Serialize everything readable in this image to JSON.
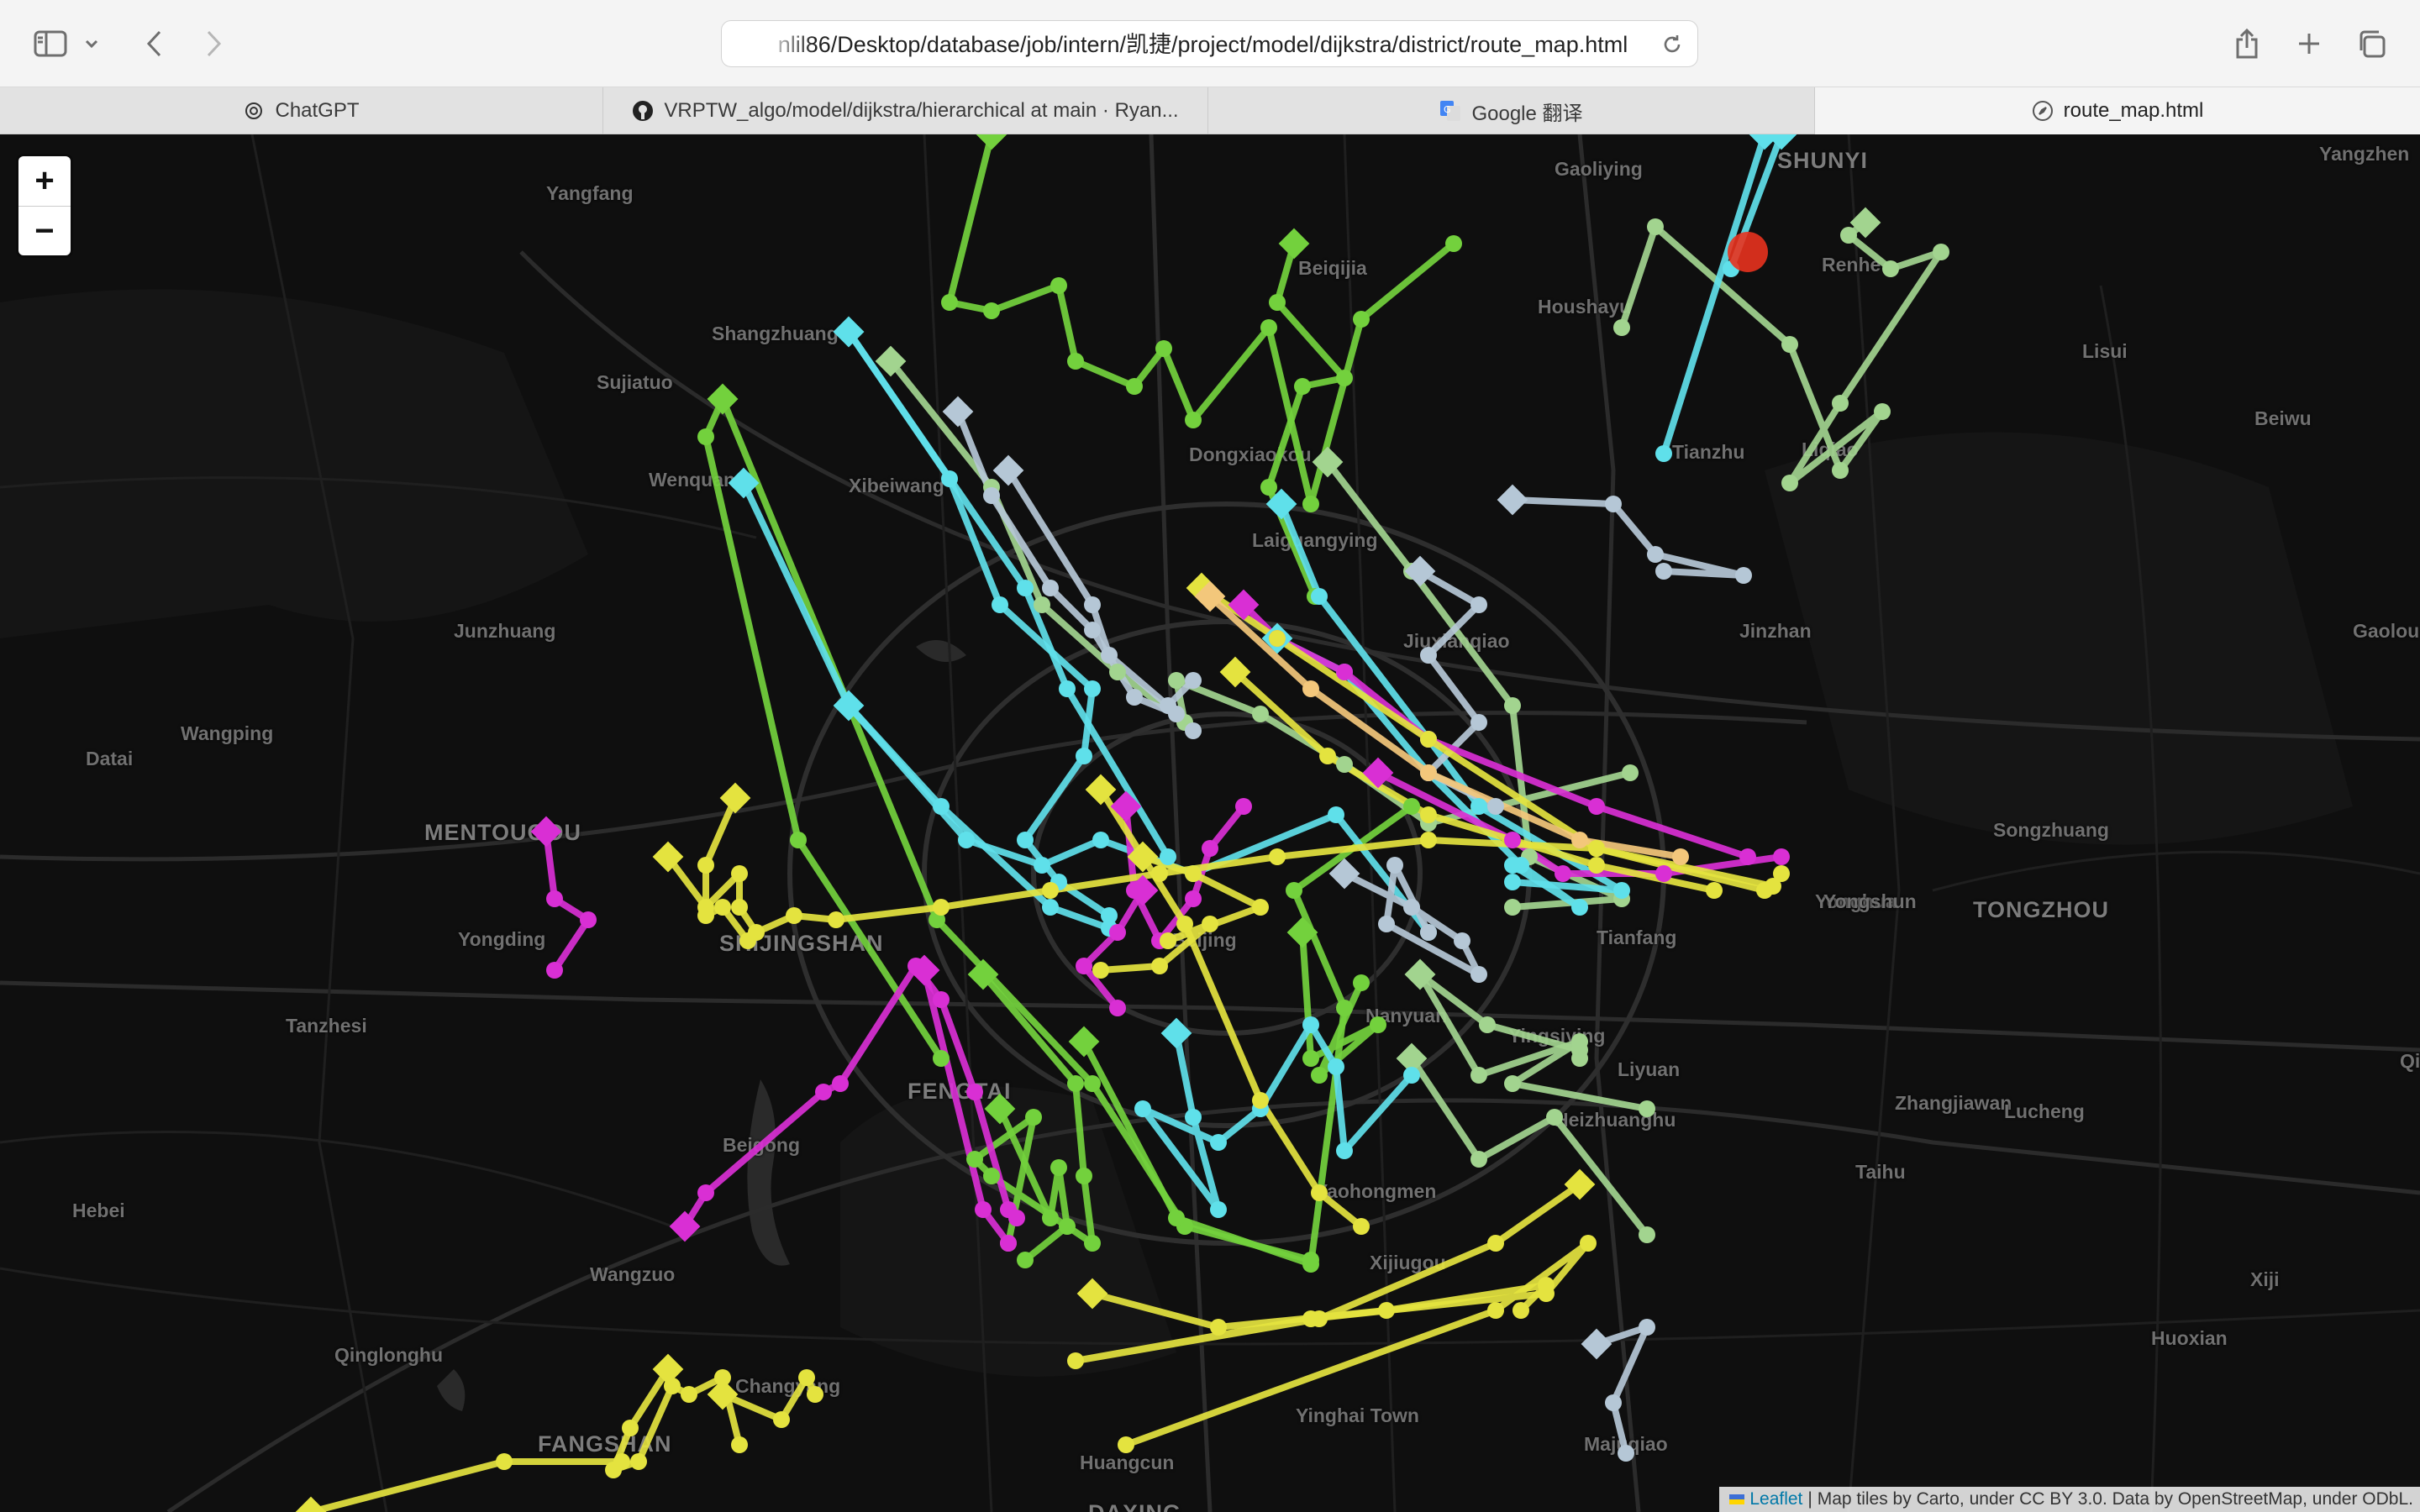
{
  "browser": {
    "url": "nlil86/Desktop/database/job/intern/凯捷/project/model/dijkstra/district/route_map.html",
    "tabs": [
      {
        "label": "ChatGPT",
        "icon": "chatgpt-icon"
      },
      {
        "label": "VRPTW_algo/model/dijkstra/hierarchical at main · Ryan...",
        "icon": "github-icon"
      },
      {
        "label": "Google 翻译",
        "icon": "google-translate-icon"
      },
      {
        "label": "route_map.html",
        "icon": "compass-icon",
        "active": true
      }
    ]
  },
  "map": {
    "zoom_in": "+",
    "zoom_out": "−",
    "attribution": {
      "leaflet": "Leaflet",
      "text": "| Map tiles by Carto, under CC BY 3.0. Data by OpenStreetMap, under ODbL."
    },
    "places": [
      {
        "name": "Yangfang"
      },
      {
        "name": "Gaoliying"
      },
      {
        "name": "SHUNYI"
      },
      {
        "name": "Yangzhen"
      },
      {
        "name": "Beiqijia"
      },
      {
        "name": "Houshayu"
      },
      {
        "name": "Renhe"
      },
      {
        "name": "Shangzhuang"
      },
      {
        "name": "Sujiatuo"
      },
      {
        "name": "Lisui"
      },
      {
        "name": "Wenquan"
      },
      {
        "name": "Xibeiwang"
      },
      {
        "name": "Dongxiaokou"
      },
      {
        "name": "Tianzhu"
      },
      {
        "name": "Liqiao"
      },
      {
        "name": "Beiwu"
      },
      {
        "name": "Laiguangying"
      },
      {
        "name": "Jinzhan"
      },
      {
        "name": "Junzhuang"
      },
      {
        "name": "Jiuxianqiao"
      },
      {
        "name": "Gaolou"
      },
      {
        "name": "Wangping"
      },
      {
        "name": "Datai"
      },
      {
        "name": "Yonghua"
      },
      {
        "name": "MENTOUGOU"
      },
      {
        "name": "Songzhuang"
      },
      {
        "name": "TONGZHOU"
      },
      {
        "name": "Yongding"
      },
      {
        "name": "SHIJINGSHAN"
      },
      {
        "name": "Beijing"
      },
      {
        "name": "Tianfang"
      },
      {
        "name": "Yongshun"
      },
      {
        "name": "Tanzhesi"
      },
      {
        "name": "FENGTAI"
      },
      {
        "name": "Nanyuan"
      },
      {
        "name": "Yingsiying"
      },
      {
        "name": "Liyuan"
      },
      {
        "name": "Zhangjiawan"
      },
      {
        "name": "Lucheng"
      },
      {
        "name": "Beigong"
      },
      {
        "name": "Heizhuanghu"
      },
      {
        "name": "Taihu"
      },
      {
        "name": "Hebei"
      },
      {
        "name": "Yaohongmen"
      },
      {
        "name": "Wangzuo"
      },
      {
        "name": "Xijiugou"
      },
      {
        "name": "Xiji"
      },
      {
        "name": "Qinglonghu"
      },
      {
        "name": "Huoxian"
      },
      {
        "name": "Changyang"
      },
      {
        "name": "Yinghai Town"
      },
      {
        "name": "FANGSHAN"
      },
      {
        "name": "Huangcun"
      },
      {
        "name": "Majuqiao"
      },
      {
        "name": "DAXING"
      },
      {
        "name": "Qi"
      }
    ],
    "route_colors": {
      "green": "#73d13d",
      "sage": "#a2d48f",
      "cyan": "#5fe0ea",
      "lightblue": "#b5c7d6",
      "magenta": "#d92fd4",
      "yellow": "#e4e33f",
      "orange": "#f3c77b",
      "red": "#e8321e"
    }
  }
}
